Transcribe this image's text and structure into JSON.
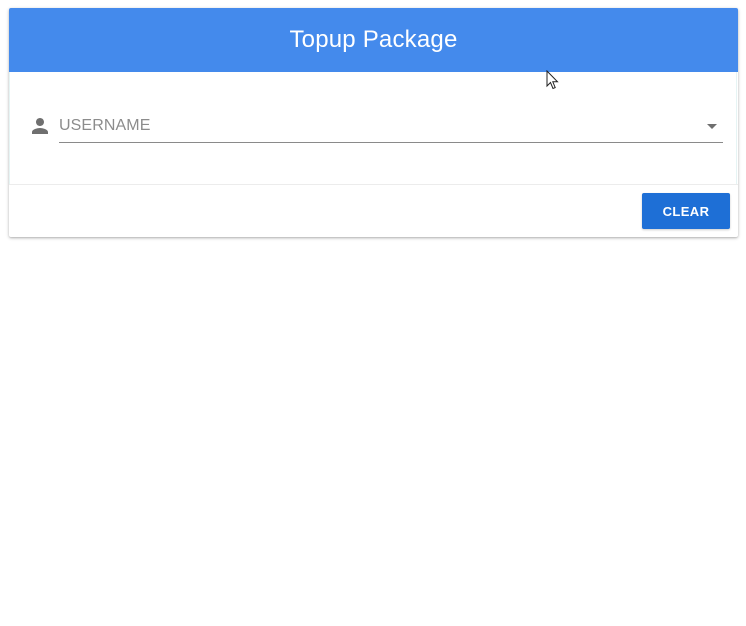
{
  "header": {
    "title": "Topup Package"
  },
  "form": {
    "username_field": {
      "label": "USERNAME",
      "icon": "person-icon",
      "dropdown_icon": "arrow-drop-down-icon"
    }
  },
  "actions": {
    "clear_label": "CLEAR"
  },
  "colors": {
    "header_bg": "#448aec",
    "button_bg": "#1e6fd6",
    "header_text": "#ffffff"
  }
}
